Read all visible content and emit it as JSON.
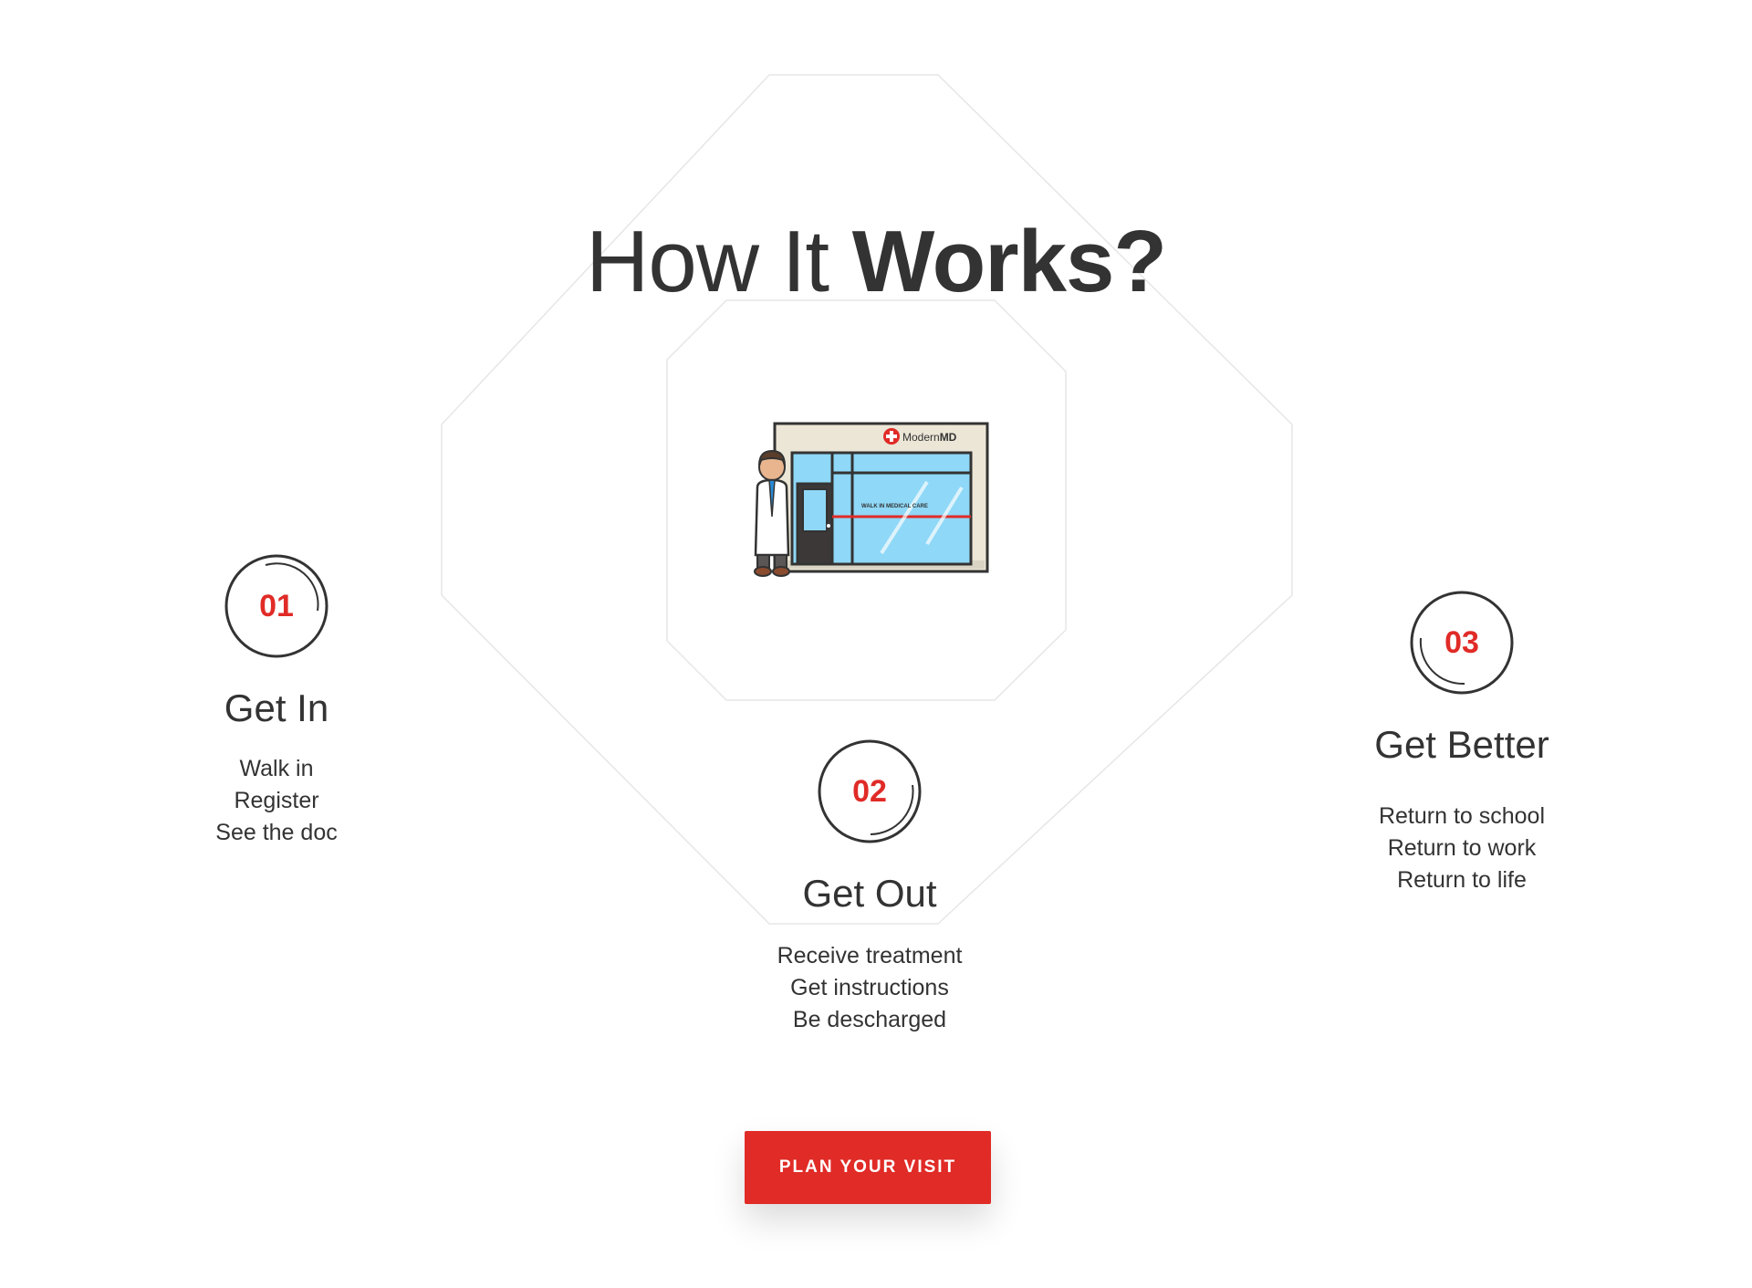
{
  "heading": {
    "light": "How It ",
    "bold": "Works?"
  },
  "illustration": {
    "sign_logo": "ModernMD",
    "sign_logo_light": "Modern",
    "sign_logo_bold": "MD",
    "window_text": "WALK IN MEDICAL CARE"
  },
  "steps": [
    {
      "number": "01",
      "title": "Get In",
      "lines": [
        "Walk in",
        "Register",
        "See the doc"
      ]
    },
    {
      "number": "02",
      "title": "Get Out",
      "lines": [
        "Receive treatment",
        "Get instructions",
        "Be descharged"
      ]
    },
    {
      "number": "03",
      "title": "Get Better",
      "lines": [
        "Return to school",
        "Return to work",
        "Return to life"
      ]
    }
  ],
  "cta": {
    "label": "PLAN YOUR VISIT"
  },
  "colors": {
    "accent": "#e02b27",
    "text": "#333333",
    "outline": "#e6e6e6",
    "glass": "#8fd8f7"
  }
}
